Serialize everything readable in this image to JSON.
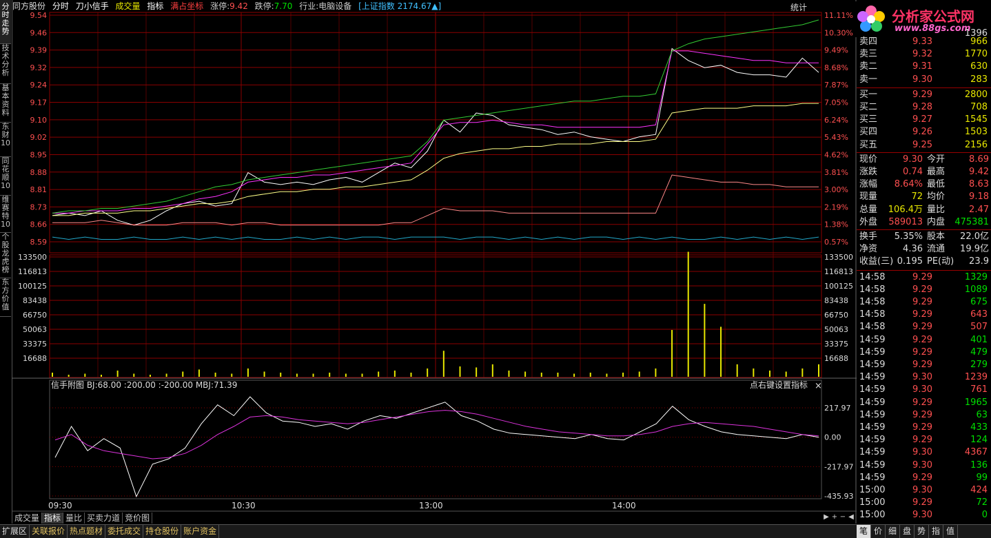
{
  "header": {
    "stock_name": "同方股份",
    "view": "分时",
    "formula": "刀小信手",
    "volume_label": "成交量",
    "indicator_label": "指标",
    "coord_label": "满占坐标",
    "limit_up_label": "涨停:",
    "limit_up": "9.42",
    "limit_down_label": "跌停:",
    "limit_down": "7.70",
    "industry": "行业:电脑设备",
    "index_text": "[上证指数 2174.67▲]",
    "stats_button": "统计"
  },
  "left_tabs": [
    "分时走势",
    "技术分析",
    "基本资料",
    "东财10",
    "同花顺10",
    "维赛特10",
    "个股龙虎榜",
    "东方价值"
  ],
  "logo": {
    "title": "分析家公式网",
    "url_text": "www.88gs.com"
  },
  "price_axis": {
    "left": [
      "9.54",
      "9.46",
      "9.39",
      "9.32",
      "9.24",
      "9.17",
      "9.10",
      "9.02",
      "8.95",
      "8.88",
      "8.81",
      "8.73",
      "8.66",
      "8.59"
    ],
    "right": [
      "11.11%",
      "10.30%",
      "9.49%",
      "8.68%",
      "7.87%",
      "7.05%",
      "6.24%",
      "5.43%",
      "4.62%",
      "3.81%",
      "3.00%",
      "2.19%",
      "1.38%",
      "0.57%"
    ]
  },
  "volume_axis": [
    "133500",
    "116813",
    "100125",
    "83438",
    "66750",
    "50063",
    "33375",
    "16688"
  ],
  "sub_chart": {
    "title": "信手附图",
    "params": "BJ:68.00  :200.00  :-200.00  MBJ:71.39",
    "hint": "点右键设置指标",
    "close": "×",
    "axis": [
      "217.97",
      "0.00",
      "-217.97",
      "-435.93"
    ]
  },
  "time_axis": [
    "09:30",
    "10:30",
    "13:00",
    "14:00"
  ],
  "bottom_tabs": [
    "成交量",
    "指标",
    "量比",
    "买卖力道",
    "竞价图"
  ],
  "bottom_tab_active": 1,
  "scroll_controls": [
    "▶",
    "+",
    "−",
    "◀"
  ],
  "status_tabs": [
    "扩展区",
    "关联报价",
    "热点题材",
    "委托成交",
    "持仓股份",
    "账户资金"
  ],
  "right_bottom_tabs": [
    "笔",
    "价",
    "细",
    "盘",
    "势",
    "指",
    "值"
  ],
  "colors": {
    "up": "#ff5050",
    "down": "#00e000",
    "neutral": "#e8e8e8",
    "grid": "#8b0000",
    "yellow": "#e8e800"
  },
  "quote": {
    "partial_row": {
      "label": "",
      "price": "",
      "vol": "1396"
    },
    "sell": [
      {
        "label": "卖四",
        "price": "9.33",
        "vol": "966"
      },
      {
        "label": "卖三",
        "price": "9.32",
        "vol": "1770"
      },
      {
        "label": "卖二",
        "price": "9.31",
        "vol": "630"
      },
      {
        "label": "卖一",
        "price": "9.30",
        "vol": "283"
      }
    ],
    "buy": [
      {
        "label": "买一",
        "price": "9.29",
        "vol": "2800"
      },
      {
        "label": "买二",
        "price": "9.28",
        "vol": "708"
      },
      {
        "label": "买三",
        "price": "9.27",
        "vol": "1545"
      },
      {
        "label": "买四",
        "price": "9.26",
        "vol": "1503"
      },
      {
        "label": "买五",
        "price": "9.25",
        "vol": "2156"
      }
    ],
    "stats": [
      {
        "l1": "现价",
        "v1": "9.30",
        "c1": "up",
        "l2": "今开",
        "v2": "8.69",
        "c2": "up"
      },
      {
        "l1": "涨跌",
        "v1": "0.74",
        "c1": "up",
        "l2": "最高",
        "v2": "9.42",
        "c2": "up"
      },
      {
        "l1": "涨幅",
        "v1": "8.64%",
        "c1": "up",
        "l2": "最低",
        "v2": "8.63",
        "c2": "up"
      },
      {
        "l1": "现量",
        "v1": "72",
        "c1": "yellow",
        "l2": "均价",
        "v2": "9.18",
        "c2": "up"
      },
      {
        "l1": "总量",
        "v1": "106.4万",
        "c1": "yellow",
        "l2": "量比",
        "v2": "2.47",
        "c2": "up"
      },
      {
        "l1": "外盘",
        "v1": "589013",
        "c1": "up",
        "l2": "内盘",
        "v2": "475381",
        "c2": "down"
      }
    ],
    "fund": [
      {
        "l1": "换手",
        "v1": "5.35%",
        "l2": "股本",
        "v2": "22.0亿"
      },
      {
        "l1": "净资",
        "v1": "4.36",
        "l2": "流通",
        "v2": "19.9亿"
      },
      {
        "l1": "收益(三)",
        "v1": "0.195",
        "l2": "PE(动)",
        "v2": "23.9"
      }
    ],
    "ticks": [
      {
        "t": "14:58",
        "p": "9.29",
        "v": "1329",
        "c": "down"
      },
      {
        "t": "14:58",
        "p": "9.29",
        "v": "1089",
        "c": "down"
      },
      {
        "t": "14:58",
        "p": "9.29",
        "v": "675",
        "c": "down"
      },
      {
        "t": "14:58",
        "p": "9.29",
        "v": "643",
        "c": "up"
      },
      {
        "t": "14:58",
        "p": "9.29",
        "v": "507",
        "c": "up"
      },
      {
        "t": "14:59",
        "p": "9.29",
        "v": "401",
        "c": "down"
      },
      {
        "t": "14:59",
        "p": "9.29",
        "v": "479",
        "c": "down"
      },
      {
        "t": "14:59",
        "p": "9.29",
        "v": "279",
        "c": "down"
      },
      {
        "t": "14:59",
        "p": "9.30",
        "v": "1239",
        "c": "up"
      },
      {
        "t": "14:59",
        "p": "9.30",
        "v": "761",
        "c": "up"
      },
      {
        "t": "14:59",
        "p": "9.29",
        "v": "1965",
        "c": "down"
      },
      {
        "t": "14:59",
        "p": "9.29",
        "v": "63",
        "c": "down"
      },
      {
        "t": "14:59",
        "p": "9.29",
        "v": "433",
        "c": "down"
      },
      {
        "t": "14:59",
        "p": "9.29",
        "v": "124",
        "c": "down"
      },
      {
        "t": "14:59",
        "p": "9.30",
        "v": "4367",
        "c": "up"
      },
      {
        "t": "14:59",
        "p": "9.30",
        "v": "136",
        "c": "down"
      },
      {
        "t": "14:59",
        "p": "9.29",
        "v": "99",
        "c": "down"
      },
      {
        "t": "15:00",
        "p": "9.30",
        "v": "424",
        "c": "up"
      },
      {
        "t": "15:00",
        "p": "9.29",
        "v": "72",
        "c": "down"
      },
      {
        "t": "15:00",
        "p": "9.30",
        "v": "0",
        "c": "down"
      }
    ]
  },
  "chart_data": {
    "type": "line",
    "x_range": [
      "09:30",
      "15:00"
    ],
    "ylim": [
      8.59,
      9.54
    ],
    "series": [
      {
        "values": [
          8.7,
          8.71,
          8.7,
          8.72,
          8.68,
          8.66,
          8.68,
          8.72,
          8.75,
          8.76,
          8.74,
          8.75,
          8.88,
          8.84,
          8.83,
          8.84,
          8.83,
          8.85,
          8.86,
          8.84,
          8.88,
          8.92,
          8.9,
          8.97,
          9.1,
          9.05,
          9.13,
          9.12,
          9.08,
          9.07,
          9.06,
          9.04,
          9.05,
          9.03,
          9.02,
          9.01,
          9.03,
          9.04,
          9.4,
          9.35,
          9.32,
          9.33,
          9.3,
          9.29,
          9.29,
          9.28,
          9.36,
          9.3
        ]
      },
      {
        "values": [
          8.71,
          8.71,
          8.72,
          8.72,
          8.72,
          8.73,
          8.73,
          8.74,
          8.75,
          8.77,
          8.78,
          8.8,
          8.84,
          8.85,
          8.86,
          8.86,
          8.87,
          8.87,
          8.88,
          8.89,
          8.9,
          8.91,
          8.92,
          9.0,
          9.08,
          9.09,
          9.09,
          9.1,
          9.09,
          9.08,
          9.08,
          9.07,
          9.07,
          9.07,
          9.07,
          9.07,
          9.07,
          9.08,
          9.39,
          9.39,
          9.38,
          9.37,
          9.36,
          9.35,
          9.35,
          9.34,
          9.34,
          9.34
        ]
      },
      {
        "values": [
          8.71,
          8.72,
          8.72,
          8.73,
          8.73,
          8.74,
          8.75,
          8.76,
          8.78,
          8.8,
          8.82,
          8.83,
          8.85,
          8.86,
          8.87,
          8.88,
          8.89,
          8.9,
          8.91,
          8.92,
          8.93,
          8.94,
          8.95,
          9.01,
          9.1,
          9.11,
          9.12,
          9.13,
          9.14,
          9.15,
          9.16,
          9.17,
          9.18,
          9.18,
          9.19,
          9.2,
          9.2,
          9.21,
          9.39,
          9.42,
          9.44,
          9.45,
          9.46,
          9.47,
          9.48,
          9.49,
          9.5,
          9.52
        ]
      },
      {
        "values": [
          8.7,
          8.7,
          8.71,
          8.71,
          8.71,
          8.72,
          8.72,
          8.73,
          8.74,
          8.75,
          8.75,
          8.76,
          8.78,
          8.79,
          8.8,
          8.8,
          8.81,
          8.81,
          8.82,
          8.82,
          8.83,
          8.84,
          8.85,
          8.89,
          8.94,
          8.96,
          8.97,
          8.98,
          8.98,
          8.99,
          8.99,
          9.0,
          9.0,
          9.0,
          9.01,
          9.01,
          9.01,
          9.02,
          9.13,
          9.14,
          9.15,
          9.15,
          9.15,
          9.16,
          9.16,
          9.16,
          9.17,
          9.17
        ]
      },
      {
        "values": [
          8.67,
          8.67,
          8.67,
          8.68,
          8.67,
          8.66,
          8.66,
          8.66,
          8.67,
          8.67,
          8.67,
          8.66,
          8.67,
          8.67,
          8.66,
          8.66,
          8.66,
          8.66,
          8.66,
          8.66,
          8.66,
          8.67,
          8.67,
          8.7,
          8.73,
          8.72,
          8.72,
          8.72,
          8.71,
          8.71,
          8.71,
          8.71,
          8.71,
          8.71,
          8.71,
          8.71,
          8.71,
          8.71,
          8.87,
          8.86,
          8.85,
          8.84,
          8.84,
          8.83,
          8.83,
          8.82,
          8.82,
          8.82
        ]
      },
      {
        "values": [
          8.61,
          8.6,
          8.61,
          8.6,
          8.6,
          8.61,
          8.6,
          8.6,
          8.61,
          8.6,
          8.61,
          8.6,
          8.61,
          8.6,
          8.6,
          8.61,
          8.6,
          8.61,
          8.6,
          8.61,
          8.61,
          8.6,
          8.61,
          8.61,
          8.61,
          8.6,
          8.61,
          8.61,
          8.6,
          8.61,
          8.6,
          8.61,
          8.6,
          8.61,
          8.61,
          8.6,
          8.61,
          8.6,
          8.61,
          8.6,
          8.6,
          8.61,
          8.6,
          8.61,
          8.6,
          8.61,
          8.6,
          8.61
        ]
      }
    ],
    "volume": [
      4,
      2,
      3,
      2,
      6,
      3,
      2,
      3,
      5,
      7,
      4,
      3,
      8,
      5,
      4,
      3,
      3,
      4,
      3,
      3,
      5,
      6,
      4,
      8,
      25,
      10,
      9,
      12,
      6,
      5,
      4,
      4,
      3,
      4,
      3,
      4,
      5,
      8,
      45,
      120,
      70,
      48,
      12,
      8,
      6,
      5,
      8,
      12
    ],
    "volume_ylim": [
      0,
      133500
    ],
    "sub_ylim": [
      -435.93,
      300
    ],
    "sub_series": [
      {
        "values": [
          -150,
          80,
          -100,
          -10,
          -80,
          -440,
          -200,
          -160,
          -80,
          100,
          240,
          160,
          300,
          180,
          120,
          110,
          80,
          100,
          60,
          120,
          160,
          140,
          180,
          220,
          260,
          160,
          120,
          60,
          30,
          20,
          10,
          0,
          -10,
          20,
          -10,
          -20,
          40,
          100,
          230,
          130,
          80,
          40,
          20,
          10,
          0,
          -10,
          20,
          0
        ]
      },
      {
        "values": [
          -20,
          20,
          -60,
          -100,
          -120,
          -140,
          -160,
          -150,
          -120,
          -60,
          20,
          80,
          150,
          160,
          150,
          130,
          120,
          110,
          100,
          110,
          130,
          150,
          170,
          190,
          200,
          190,
          170,
          140,
          110,
          80,
          60,
          40,
          30,
          20,
          10,
          10,
          20,
          40,
          80,
          100,
          110,
          100,
          90,
          80,
          60,
          40,
          20,
          10
        ]
      }
    ]
  }
}
